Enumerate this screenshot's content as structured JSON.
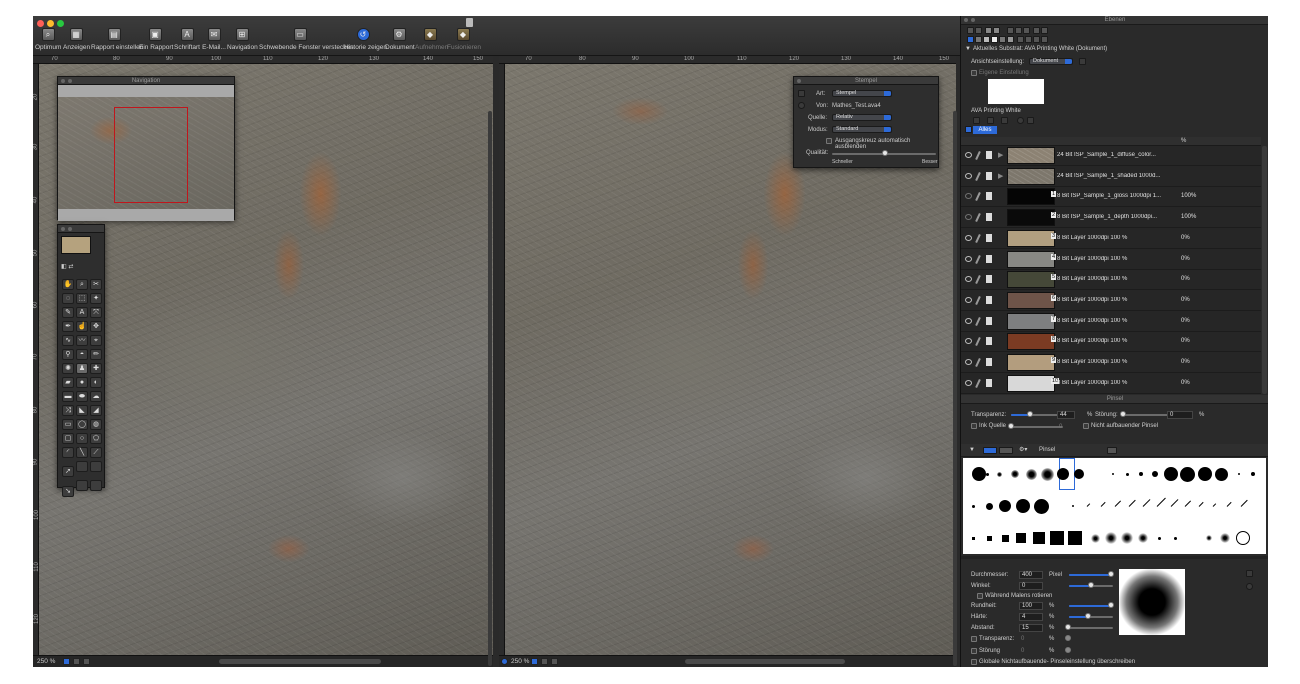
{
  "toolbar": {
    "items": [
      {
        "label": "Optimum",
        "icon": "optimum-icon",
        "enabled": true
      },
      {
        "label": "Anzeigen",
        "icon": "display-icon",
        "enabled": true
      },
      {
        "label": "Rapport einstellen",
        "icon": "rapport-settings-icon",
        "enabled": true
      },
      {
        "label": "Ein Rapport",
        "icon": "single-rapport-icon",
        "enabled": true
      },
      {
        "label": "Schriftart",
        "icon": "font-icon",
        "enabled": true
      },
      {
        "label": "E-Mail...",
        "icon": "email-icon",
        "enabled": true
      },
      {
        "label": "Navigation",
        "icon": "navigation-icon",
        "enabled": true
      },
      {
        "label": "Schwebende Fenster verstecken",
        "icon": "hide-floating-windows-icon",
        "enabled": true
      },
      {
        "label": "Historie zeigen",
        "icon": "history-icon",
        "enabled": true
      },
      {
        "label": "Dokument",
        "icon": "document-icon",
        "enabled": true
      },
      {
        "label": "Aufnehmen",
        "icon": "record-icon",
        "enabled": false
      },
      {
        "label": "Fusionieren",
        "icon": "merge-icon",
        "enabled": false
      }
    ]
  },
  "left_pane": {
    "ruler_h": [
      "70",
      "80",
      "90",
      "100",
      "110",
      "120",
      "130",
      "140",
      "150"
    ],
    "ruler_v": [
      "20",
      "30",
      "40",
      "50",
      "60",
      "70",
      "80",
      "90",
      "100",
      "110",
      "120"
    ],
    "zoom": "250 %"
  },
  "right_pane": {
    "ruler_h": [
      "70",
      "80",
      "90",
      "100",
      "110",
      "120",
      "130",
      "140",
      "150"
    ],
    "zoom": "250 %"
  },
  "navigation_panel": {
    "title": "Navigation"
  },
  "stempel_panel": {
    "title": "Stempel",
    "art_label": "Art:",
    "art_value": "Stempel",
    "von_label": "Von:",
    "von_value": "Mathes_Test.ava4",
    "quelle_label": "Quelle:",
    "quelle_value": "Relativ",
    "modus_label": "Modus:",
    "modus_value": "Standard",
    "auto_hide_label": "Ausgangskreuz automatisch ausblenden",
    "quality_label": "Qualität:",
    "faster_label": "Schneller",
    "better_label": "Besser"
  },
  "layers_panel": {
    "title": "Ebenen",
    "substrate": "Aktuelles Substrat: AVA Printing White (Dokument)",
    "view_setting_label": "Ansichtseinstellung:",
    "view_setting_value": "Dokument",
    "own_setting_label": "Eigene Einstellung",
    "substrate_name": "AVA Printing White",
    "tab_label": "Alles",
    "pct_header": "%",
    "layers": [
      {
        "name": "24 Bit ISP_Sample_1_diffuse_color...",
        "pct": "",
        "thumb": "#8c8273",
        "badge": ""
      },
      {
        "name": "24 Bit ISP_Sample_1_shaded 1000d...",
        "pct": "",
        "thumb": "#7d776c",
        "badge": ""
      },
      {
        "name": "8 Bit ISP_Sample_1_gloss 1000dpi 1...",
        "pct": "100%",
        "thumb": "#050505",
        "badge": "1"
      },
      {
        "name": "8 Bit ISP_Sample_1_depth 1000dpi...",
        "pct": "100%",
        "thumb": "#0a0a0a",
        "badge": "2"
      },
      {
        "name": "8 Bit  Layer 1000dpi 100 %",
        "pct": "0%",
        "thumb": "#b19f80",
        "badge": "3"
      },
      {
        "name": "8 Bit  Layer 1000dpi 100 %",
        "pct": "0%",
        "thumb": "#888884",
        "badge": "4"
      },
      {
        "name": "8 Bit  Layer 1000dpi 100 %",
        "pct": "0%",
        "thumb": "#454838",
        "badge": "5"
      },
      {
        "name": "8 Bit  Layer 1000dpi 100 %",
        "pct": "0%",
        "thumb": "#6e5449",
        "badge": "6"
      },
      {
        "name": "8 Bit  Layer 1000dpi 100 %",
        "pct": "0%",
        "thumb": "#7e7f80",
        "badge": "7"
      },
      {
        "name": "8 Bit  Layer 1000dpi 100 %",
        "pct": "0%",
        "thumb": "#7b3b23",
        "badge": "8"
      },
      {
        "name": "8 Bit  Layer 1000dpi 100 %",
        "pct": "0%",
        "thumb": "#b39d7e",
        "badge": "9"
      },
      {
        "name": "8 Bit  Layer 1000dpi 100 %",
        "pct": "0%",
        "thumb": "#d8d8d8",
        "badge": "10"
      }
    ]
  },
  "brush_panel": {
    "title": "Pinsel",
    "transparency_label": "Transparenz:",
    "transparency_value": "44",
    "transparency_unit": "%",
    "noise_label": "Störung:",
    "noise_value": "0",
    "noise_unit": "%",
    "ink_source_label": "Ink Quelle",
    "ink_source_value": "0",
    "non_build_label": "Nicht aufbauender Pinsel",
    "preset_label": "Pinsel",
    "diameter_label": "Durchmesser:",
    "diameter_value": "400",
    "diameter_unit": "Pixel",
    "angle_label": "Winkel:",
    "angle_value": "0",
    "rotate_label": "Während Malens rotieren",
    "roundness_label": "Rundheit:",
    "roundness_value": "100",
    "roundness_unit": "%",
    "hardness_label": "Härte:",
    "hardness_value": "4",
    "hardness_unit": "%",
    "spacing_label": "Abstand:",
    "spacing_value": "15",
    "spacing_unit": "%",
    "transparency2_label": "Transparenz:",
    "transparency2_value": "0",
    "transparency2_unit": "%",
    "noise2_label": "Störung",
    "noise2_value": "0",
    "noise2_unit": "%",
    "global_label": "Globale Nichtaufbauende- Pinseleinstellung überschreiben"
  },
  "colors": {
    "accent": "#2d6ad8",
    "nav_frame": "#c0161c"
  }
}
